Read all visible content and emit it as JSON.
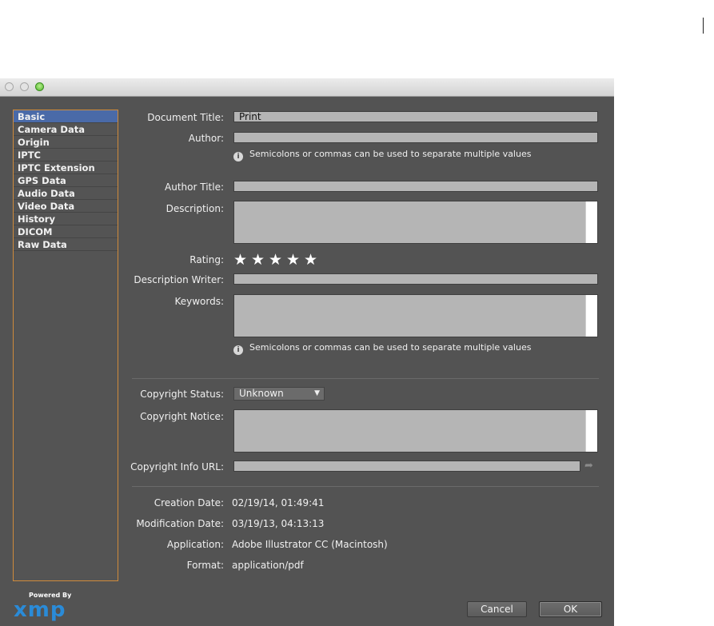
{
  "sidebar": {
    "items": [
      {
        "label": "Basic"
      },
      {
        "label": "Camera Data"
      },
      {
        "label": "Origin"
      },
      {
        "label": "IPTC"
      },
      {
        "label": "IPTC Extension"
      },
      {
        "label": "GPS Data"
      },
      {
        "label": "Audio Data"
      },
      {
        "label": "Video Data"
      },
      {
        "label": "History"
      },
      {
        "label": "DICOM"
      },
      {
        "label": "Raw Data"
      }
    ],
    "selected": "Basic"
  },
  "branding": {
    "powered_by": "Powered By",
    "logo": "xmp"
  },
  "form": {
    "document_title_label": "Document Title:",
    "document_title_value": "Print",
    "author_label": "Author:",
    "author_value": "",
    "author_hint": "Semicolons or commas can be used to separate multiple values",
    "author_title_label": "Author Title:",
    "author_title_value": "",
    "description_label": "Description:",
    "rating_label": "Rating:",
    "rating_value": 0,
    "rating_max": 5,
    "description_writer_label": "Description Writer:",
    "description_writer_value": "",
    "keywords_label": "Keywords:",
    "keywords_hint": "Semicolons or commas can be used to separate multiple values",
    "copyright_status_label": "Copyright Status:",
    "copyright_status_value": "Unknown",
    "copyright_notice_label": "Copyright Notice:",
    "copyright_url_label": "Copyright Info URL:",
    "copyright_url_value": ""
  },
  "info": {
    "creation_date_label": "Creation Date:",
    "creation_date_value": "02/19/14, 01:49:41",
    "modification_date_label": "Modification Date:",
    "modification_date_value": "03/19/13, 04:13:13",
    "application_label": "Application:",
    "application_value": "Adobe Illustrator CC (Macintosh)",
    "format_label": "Format:",
    "format_value": "application/pdf"
  },
  "buttons": {
    "cancel": "Cancel",
    "ok": "OK"
  },
  "icons": {
    "info": "info-icon",
    "star": "star-icon",
    "share": "share-arrow-icon",
    "chevron": "chevron-down-icon",
    "star_glyph": "★",
    "info_glyph": "i",
    "chevron_glyph": "▼",
    "share_glyph": "➦"
  },
  "colors": {
    "accent": "#4a6aa8",
    "sidebar_border": "#d08b3b",
    "panel": "#535353"
  }
}
